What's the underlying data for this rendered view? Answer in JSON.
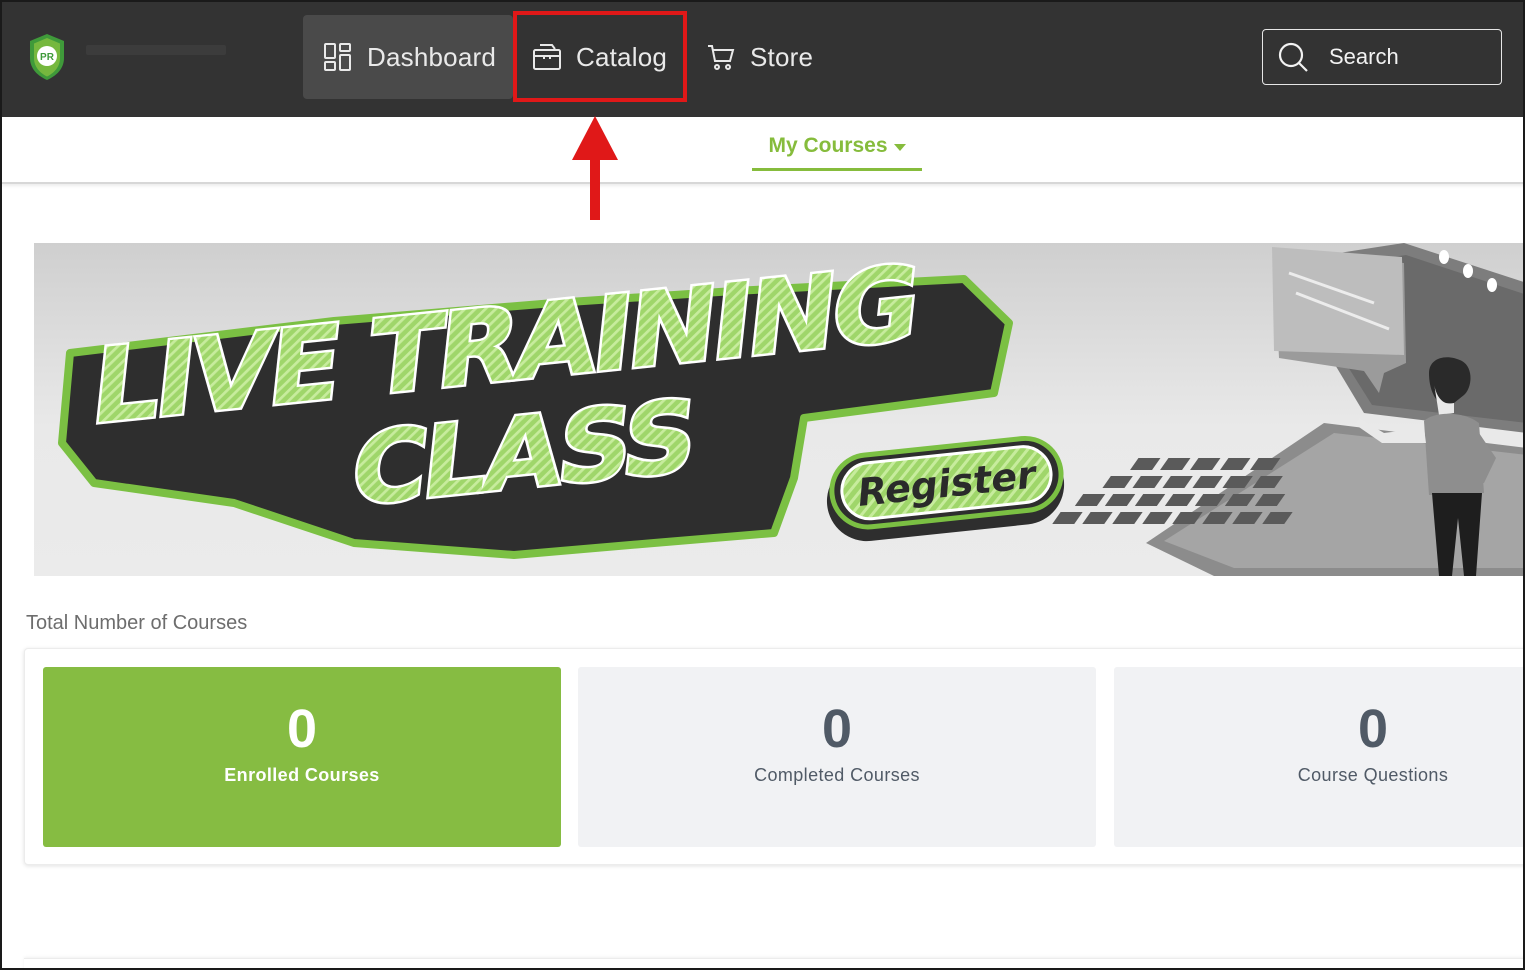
{
  "nav": {
    "items": [
      {
        "label": "Dashboard",
        "icon": "dashboard-grid-icon",
        "active": true
      },
      {
        "label": "Catalog",
        "icon": "folder-icon",
        "highlighted": true
      },
      {
        "label": "Store",
        "icon": "cart-icon"
      }
    ],
    "search_label": "Search",
    "logo_badge": "PR",
    "colors": {
      "bar": "#333333",
      "highlight": "#e01818"
    }
  },
  "subnav": {
    "my_courses_label": "My Courses",
    "accent": "#86bc3c"
  },
  "banner": {
    "line1": "LIVE TRAINING",
    "line2": "CLASS",
    "cta": "Register"
  },
  "stats": {
    "title": "Total Number of Courses",
    "cards": [
      {
        "value": "0",
        "label": "Enrolled Courses",
        "color": "#86bc42"
      },
      {
        "value": "0",
        "label": "Completed Courses"
      },
      {
        "value": "0",
        "label": "Course Questions"
      }
    ]
  }
}
